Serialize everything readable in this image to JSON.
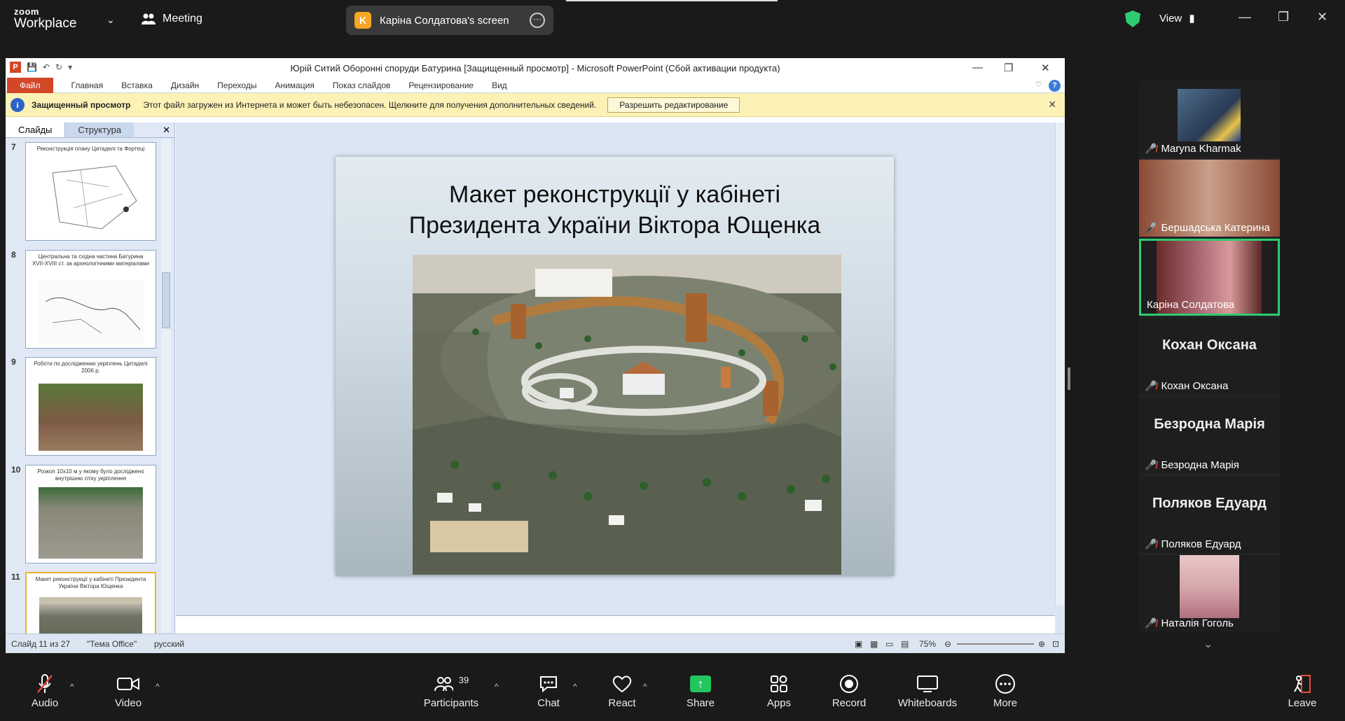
{
  "zoom": {
    "logo_top": "zoom",
    "logo_bottom": "Workplace",
    "meeting_label": "Meeting",
    "share_initial": "K",
    "share_label": "Карiна Солдатова's screen",
    "view_label": "View"
  },
  "ppt": {
    "window_title": "Юрій Ситий Оборонні споруди Батурина [Защищенный просмотр]  -  Microsoft PowerPoint (Сбой активации продукта)",
    "file_tab": "Файл",
    "tabs": [
      "Главная",
      "Вставка",
      "Дизайн",
      "Переходы",
      "Анимация",
      "Показ слайдов",
      "Рецензирование",
      "Вид"
    ],
    "msg_bold": "Защищенный просмотр",
    "msg_text": "Этот файл загружен из Интернета и может быть небезопасен. Щелкните для получения дополнительных сведений.",
    "msg_button": "Разрешить редактирование",
    "panel_tab_slides": "Слайды",
    "panel_tab_outline": "Структура",
    "thumbnails": [
      {
        "num": "7",
        "title": "Реконструкція плану Цитаделі та Фортеці"
      },
      {
        "num": "8",
        "title": "Центральна та східна частина Батурина XVII-XVIII ст. за археологічними матеріалами"
      },
      {
        "num": "9",
        "title": "Роботи по дослідженню укріплень Цитаделі 2006 р."
      },
      {
        "num": "10",
        "title": "Розкоп 10х10 м у якому було досліджено внутрішню сітку укріплення"
      },
      {
        "num": "11",
        "title": "Макет реконструкції у кабінеті Президента України Віктора Ющенка"
      }
    ],
    "slide_title_line1": "Макет реконструкції у кабінеті",
    "slide_title_line2": "Президента України Віктора Ющенка",
    "status_slide": "Слайд 11 из 27",
    "status_theme": "\"Тема Office\"",
    "status_lang": "русский",
    "zoom_level": "75%"
  },
  "participants": [
    {
      "name": "Maryna Kharmak",
      "has_video": true
    },
    {
      "name": "Бершадська Катерина",
      "has_video": true
    },
    {
      "name": "Карiна Солдатова",
      "has_video": true,
      "speaking": true
    },
    {
      "name": "Кохан Оксана",
      "has_video": false
    },
    {
      "name": "Безродна Марія",
      "has_video": false
    },
    {
      "name": "Поляков Едуард",
      "has_video": false
    },
    {
      "name": "Наталія Гоголь",
      "has_video": true
    }
  ],
  "toolbar": {
    "audio": "Audio",
    "video": "Video",
    "participants": "Participants",
    "participants_count": "39",
    "chat": "Chat",
    "react": "React",
    "share": "Share",
    "apps": "Apps",
    "record": "Record",
    "whiteboards": "Whiteboards",
    "more": "More",
    "leave": "Leave"
  },
  "colors": {
    "accent_green": "#2ecc71",
    "ppt_file_tab": "#d24726",
    "protected_bar": "#fcf2b6",
    "mic_muted": "#e74c3c"
  }
}
